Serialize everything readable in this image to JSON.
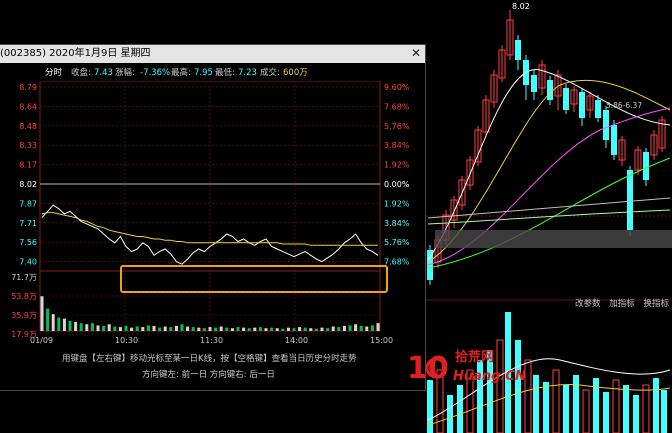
{
  "window": {
    "title": "(002385) 2020年1月9日 星期四",
    "close_glyph": "✕"
  },
  "info": {
    "tab": "分时",
    "close_label": "收盘:",
    "close_value": "7.43",
    "change_label": "涨幅:",
    "change_value": "-7.36%",
    "high_label": "最高:",
    "high_value": "7.95",
    "low_label": "最低:",
    "low_value": "7.23",
    "volume_label": "成交:",
    "volume_value": "600万"
  },
  "chart_data": {
    "type": "line",
    "title": "",
    "x_ticks": [
      "01/09",
      "10:30",
      "11:30",
      "14:00",
      "15:00"
    ],
    "price_ticks_left": [
      "8.79",
      "8.64",
      "8.48",
      "8.33",
      "8.17",
      "8.02",
      "7.87",
      "7.71",
      "7.56",
      "7.40"
    ],
    "price_ticks_right": [
      "9.60%",
      "7.68%",
      "5.76%",
      "3.84%",
      "1.92%",
      "0.00%",
      "1.92%",
      "3.84%",
      "5.76%",
      "7.68%"
    ],
    "volume_ticks": [
      "71.7万",
      "53.8万",
      "35.9万",
      "17.9万"
    ],
    "ylim": [
      7.23,
      8.79
    ],
    "prev_close": 8.02,
    "series": [
      {
        "values": [
          7.75,
          7.8,
          7.85,
          7.82,
          7.78,
          7.8,
          7.76,
          7.72,
          7.7,
          7.68,
          7.66,
          7.62,
          7.58,
          7.55,
          7.6,
          7.52,
          7.48,
          7.5,
          7.55,
          7.52,
          7.45,
          7.48,
          7.5,
          7.46,
          7.4,
          7.38,
          7.42,
          7.47,
          7.5,
          7.48,
          7.52,
          7.55,
          7.58,
          7.62,
          7.6,
          7.56,
          7.58,
          7.55,
          7.53,
          7.56,
          7.58,
          7.52,
          7.5,
          7.48,
          7.46,
          7.44,
          7.46,
          7.48,
          7.45,
          7.42,
          7.4,
          7.43,
          7.46,
          7.5,
          7.55,
          7.58,
          7.62,
          7.55,
          7.5,
          7.48,
          7.45
        ]
      },
      {
        "values": [
          7.78,
          7.79,
          7.79,
          7.78,
          7.77,
          7.76,
          7.75,
          7.73,
          7.72,
          7.7,
          7.68,
          7.67,
          7.65,
          7.64,
          7.63,
          7.62,
          7.61,
          7.6,
          7.6,
          7.59,
          7.58,
          7.58,
          7.57,
          7.57,
          7.56,
          7.56,
          7.55,
          7.55,
          7.55,
          7.55,
          7.55,
          7.55,
          7.55,
          7.55,
          7.55,
          7.55,
          7.55,
          7.55,
          7.55,
          7.55,
          7.55,
          7.55,
          7.55,
          7.54,
          7.54,
          7.54,
          7.54,
          7.54,
          7.53,
          7.53,
          7.53,
          7.53,
          7.53,
          7.53,
          7.53,
          7.53,
          7.53,
          7.53,
          7.53,
          7.53,
          7.53
        ]
      }
    ],
    "volume": [
      62,
      40,
      30,
      24,
      22,
      18,
      16,
      14,
      12,
      14,
      10,
      9,
      12,
      8,
      7,
      9,
      6,
      8,
      7,
      10,
      9,
      6,
      8,
      7,
      9,
      12,
      8,
      7,
      6,
      5,
      7,
      6,
      8,
      6,
      5,
      7,
      6,
      5,
      6,
      7,
      5,
      6,
      5,
      4,
      6,
      5,
      7,
      6,
      5,
      4,
      6,
      5,
      8,
      7,
      9,
      10,
      12,
      9,
      8,
      10,
      14
    ],
    "volume_max": 71.7
  },
  "help": {
    "line1": "用键盘【左右键】移动光标至某一日K线，按【空格键】查看当日历史分时走势",
    "line2": "方向键左: 前一日    方向键右: 后一日"
  },
  "kline": {
    "peak_label": "8.02",
    "ma_label": "5.86-6.37"
  },
  "right_buttons": [
    "改参数",
    "加指标",
    "换指标"
  ],
  "logo": {
    "mark": "10",
    "cn": "拾荒网",
    "en": "Huang.CN"
  },
  "colors": {
    "accent_orange": "#f0a010",
    "price_line": "#ffffff",
    "avg_line": "#e8d040",
    "up_red": "#ff4040",
    "down_cyan": "#40ffff",
    "volume_green": "#00c050",
    "grid_red": "#6a1010"
  }
}
